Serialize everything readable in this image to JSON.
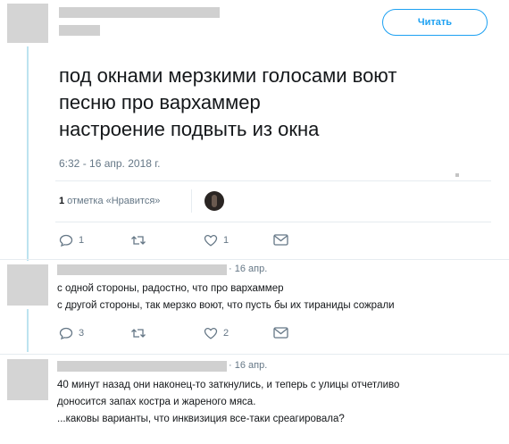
{
  "tweet": {
    "follow_label": "Читать",
    "text_lines": [
      "под окнами мерзкими голосами воют",
      "песню про вархаммер",
      "настроение подвыть из окна"
    ],
    "timestamp": "6:32 - 16 апр. 2018 г.",
    "likes_count": "1",
    "likes_label": "отметка «Нравится»",
    "actions": {
      "replies": "1",
      "retweets": "",
      "likes": "1"
    }
  },
  "replies": [
    {
      "date": "· 16 апр.",
      "lines": [
        "с одной стороны, радостно, что про вархаммер",
        "с другой стороны, так мерзко воют, что пусть бы их тираниды сожрали"
      ],
      "actions": {
        "replies": "3",
        "retweets": "",
        "likes": "2"
      }
    },
    {
      "date": "· 16 апр.",
      "lines": [
        "40 минут назад они наконец-то заткнулись, и теперь с улицы отчетливо",
        "доносится запах костра и жареного мяса.",
        "...каковы варианты, что инквизиция все-таки среагировала?"
      ]
    }
  ],
  "colors": {
    "accent": "#1da1f2",
    "thread": "#bde3f0",
    "muted": "#657786"
  }
}
